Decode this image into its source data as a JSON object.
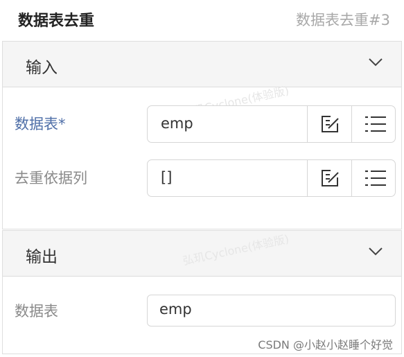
{
  "header": {
    "title": "数据表去重",
    "subtitle": "数据表去重#3"
  },
  "input_section": {
    "title": "输入",
    "fields": [
      {
        "label": "数据表*",
        "value": "emp"
      },
      {
        "label": "去重依据列",
        "value": "[]"
      }
    ]
  },
  "output_section": {
    "title": "输出",
    "fields": [
      {
        "label": "数据表",
        "value": "emp"
      }
    ]
  },
  "watermark": "弘玑Cyclone(体验版)",
  "footer_credit": "CSDN @小赵小赵睡个好觉",
  "icons": {
    "chevron": "chevron-down-icon",
    "edit": "edit-icon",
    "list": "list-icon"
  },
  "colors": {
    "required_label": "#4f6fa8",
    "border": "#d6d6d6",
    "section_header_bg": "#f5f5f5"
  }
}
